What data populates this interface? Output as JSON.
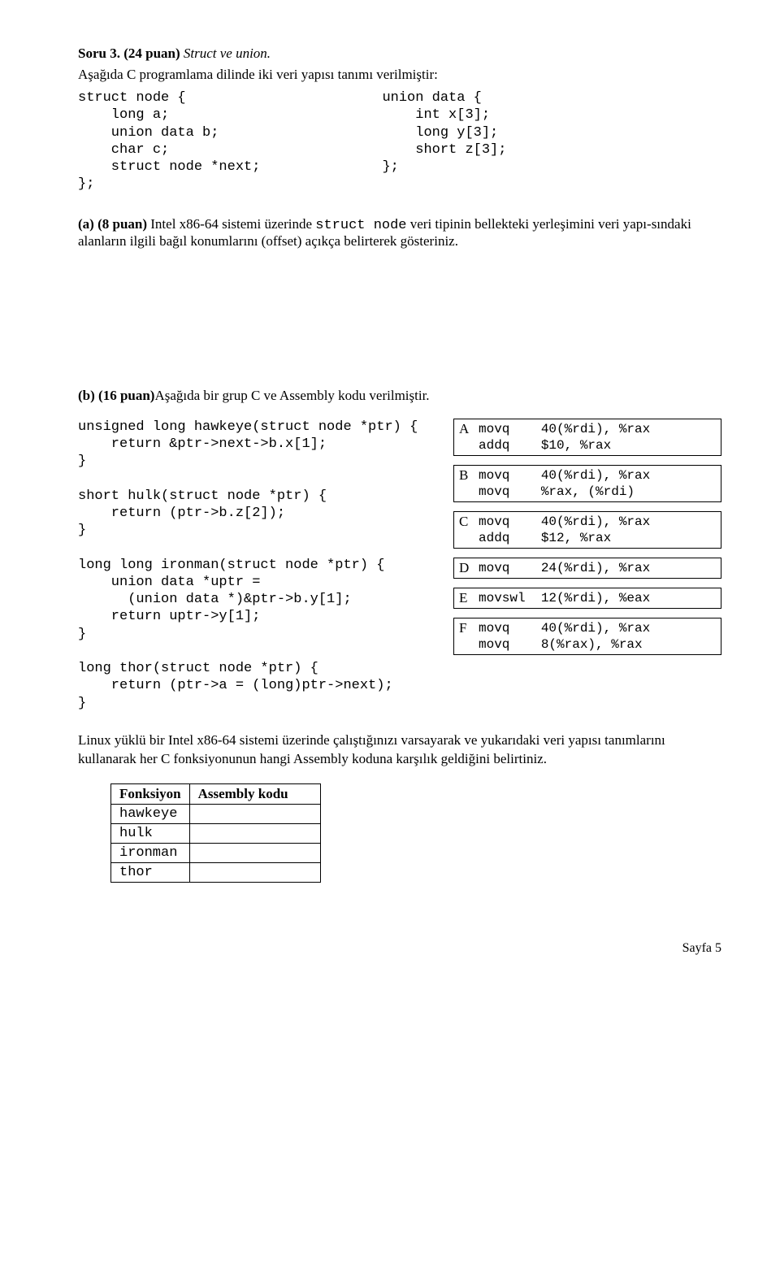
{
  "title": {
    "prefix": "Soru 3. (24 puan)",
    "suffix": " Struct ve union."
  },
  "intro": "Aşağıda C programlama dilinde iki veri yapısı tanımı verilmiştir:",
  "struct_node": "struct node {\n    long a;\n    union data b;\n    char c;\n    struct node *next;\n};",
  "union_data": "union data {\n    int x[3];\n    long y[3];\n    short z[3];\n};",
  "part_a": {
    "label": "(a)",
    "points": "(8 puan)",
    "text_before_code": " Intel x86-64 sistemi üzerinde ",
    "code": "struct node",
    "text_after_code": " veri tipinin bellekteki yerleşimini veri yapı-sındaki alanların ilgili bağıl konumlarını (offset) açıkça belirterek gösteriniz."
  },
  "part_b": {
    "label": "(b)",
    "points": "(16 puan)",
    "text": "Aşağıda bir grup C ve Assembly kodu verilmiştir."
  },
  "c_code": "unsigned long hawkeye(struct node *ptr) {\n    return &ptr->next->b.x[1];\n}\n\nshort hulk(struct node *ptr) {\n    return (ptr->b.z[2]);\n}\n\nlong long ironman(struct node *ptr) {\n    union data *uptr =\n      (union data *)&ptr->b.y[1];\n    return uptr->y[1];\n}\n\nlong thor(struct node *ptr) {\n    return (ptr->a = (long)ptr->next);\n}",
  "asm": [
    {
      "label": "A",
      "code": "movq    40(%rdi), %rax\naddq    $10, %rax"
    },
    {
      "label": "B",
      "code": "movq    40(%rdi), %rax\nmovq    %rax, (%rdi)"
    },
    {
      "label": "C",
      "code": "movq    40(%rdi), %rax\naddq    $12, %rax"
    },
    {
      "label": "D",
      "code": "movq    24(%rdi), %rax"
    },
    {
      "label": "E",
      "code": "movswl  12(%rdi), %eax"
    },
    {
      "label": "F",
      "code": "movq    40(%rdi), %rax\nmovq    8(%rax), %rax"
    }
  ],
  "closing": "Linux yüklü bir Intel x86-64 sistemi üzerinde çalıştığınızı varsayarak ve yukarıdaki veri yapısı tanımlarını kullanarak her C fonksiyonunun hangi Assembly koduna karşılık geldiğini belirtiniz.",
  "answer_table": {
    "headers": [
      "Fonksiyon",
      "Assembly kodu"
    ],
    "rows": [
      "hawkeye",
      "hulk",
      "ironman",
      "thor"
    ]
  },
  "footer": "Sayfa 5"
}
